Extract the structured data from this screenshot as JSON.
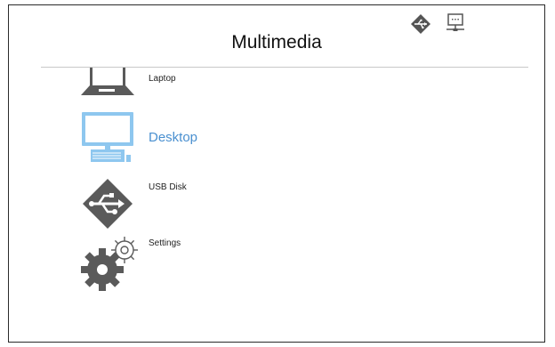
{
  "header": {
    "title": "Multimedia"
  },
  "status_icons": [
    {
      "name": "usb-status-icon"
    },
    {
      "name": "network-status-icon"
    }
  ],
  "menu": {
    "selected": "Desktop",
    "items": [
      {
        "label": "Laptop",
        "icon": "laptop-icon"
      },
      {
        "label": "Desktop",
        "icon": "desktop-icon"
      },
      {
        "label": "USB Disk",
        "icon": "usb-disk-icon"
      },
      {
        "label": "Settings",
        "icon": "settings-icon"
      }
    ]
  },
  "colors": {
    "icon_gray": "#555555",
    "accent_blue": "#4a90d0",
    "divider": "#c8c8c8"
  }
}
